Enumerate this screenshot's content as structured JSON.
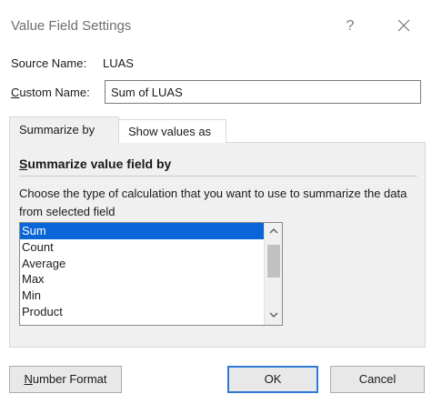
{
  "dialog": {
    "title": "Value Field Settings",
    "help_glyph": "?",
    "close_icon": "close-icon"
  },
  "source": {
    "label": "Source Name:",
    "value": "LUAS"
  },
  "custom_name": {
    "label_first": "C",
    "label_rest": "ustom Name:",
    "value": "Sum of LUAS"
  },
  "tabs": [
    {
      "label": "Summarize by",
      "active": true
    },
    {
      "label": "Show values as",
      "active": false
    }
  ],
  "summarize": {
    "title_first": "S",
    "title_rest": "ummarize value field by",
    "description": "Choose the type of calculation that you want to use to summarize the data from selected field",
    "items": [
      "Sum",
      "Count",
      "Average",
      "Max",
      "Min",
      "Product"
    ],
    "selected": "Sum"
  },
  "buttons": {
    "number_format_first": "N",
    "number_format_rest": "umber Format",
    "ok": "OK",
    "cancel": "Cancel"
  },
  "colors": {
    "selection": "#0a66d8",
    "ok_border": "#2c7ad6",
    "panel": "#f0f0f0"
  }
}
